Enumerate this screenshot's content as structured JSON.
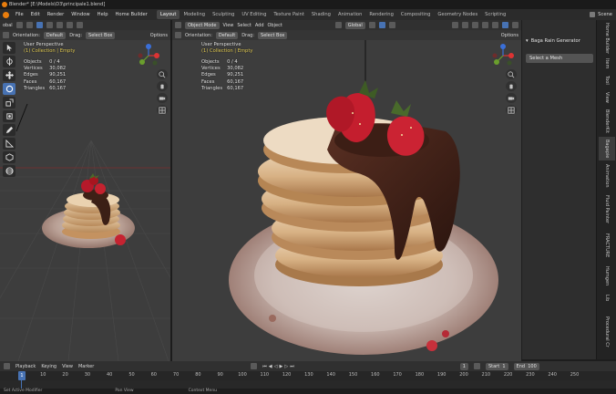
{
  "window": {
    "title": "Blender* [E:\\Models\\D3\\principale1.blend]"
  },
  "menu": [
    "File",
    "Edit",
    "Render",
    "Window",
    "Help",
    "Home Builder"
  ],
  "workspaces": [
    {
      "label": "Layout",
      "active": true
    },
    {
      "label": "Modeling",
      "active": false
    },
    {
      "label": "Sculpting",
      "active": false
    },
    {
      "label": "UV Editing",
      "active": false
    },
    {
      "label": "Texture Paint",
      "active": false
    },
    {
      "label": "Shading",
      "active": false
    },
    {
      "label": "Animation",
      "active": false
    },
    {
      "label": "Rendering",
      "active": false
    },
    {
      "label": "Compositing",
      "active": false
    },
    {
      "label": "Geometry Nodes",
      "active": false
    },
    {
      "label": "Scripting",
      "active": false
    }
  ],
  "scene_label": "Scene",
  "left_viewport": {
    "header": {
      "orientation_label": "Orientation:",
      "orientation_value": "Default",
      "drag_label": "Drag:",
      "drag_value": "Select Box",
      "options": "Options",
      "cut_label": "obal"
    },
    "view_name": "User Perspective",
    "collection": "(1) Collection | Empty",
    "stats": [
      [
        "Objects",
        "0 / 4"
      ],
      [
        "Vertices",
        "30,082"
      ],
      [
        "Edges",
        "90,251"
      ],
      [
        "Faces",
        "60,167"
      ],
      [
        "Triangles",
        "60,167"
      ]
    ]
  },
  "right_viewport": {
    "header": {
      "mode": "Object Mode",
      "view": "View",
      "select": "Select",
      "add": "Add",
      "object": "Object",
      "transform": "Global",
      "orientation_label": "Orientation:",
      "orientation_value": "Default",
      "drag_label": "Drag:",
      "drag_value": "Select Box",
      "options": "Options"
    },
    "view_name": "User Perspective",
    "collection": "(1) Collection | Empty",
    "stats": [
      [
        "Objects",
        "0 / 4"
      ],
      [
        "Vertices",
        "30,082"
      ],
      [
        "Edges",
        "90,251"
      ],
      [
        "Faces",
        "60,167"
      ],
      [
        "Triangles",
        "60,167"
      ]
    ]
  },
  "npanel": {
    "title": "Baga Rain Generator",
    "button": "Select a Mesh",
    "tabs": [
      "Home Builder",
      "Item",
      "Tool",
      "View",
      "BlenderKit",
      "Bagapie",
      "Animation",
      "Fluid Painter",
      "FRACTURE",
      "Humgen",
      "Lib",
      "Procedural Cr"
    ]
  },
  "timeline": {
    "playback": "Playback",
    "keying": "Keying",
    "view": "View",
    "marker": "Marker",
    "current_frame": "1",
    "start_label": "Start",
    "start_value": "1",
    "end_label": "End",
    "end_value": "100",
    "ticks": [
      "10",
      "20",
      "30",
      "40",
      "50",
      "60",
      "70",
      "80",
      "90",
      "100",
      "110",
      "120",
      "130",
      "140",
      "150",
      "160",
      "170",
      "180",
      "190",
      "200",
      "210",
      "220",
      "230",
      "240",
      "250"
    ],
    "cursor_frame": "1"
  },
  "statusbar": [
    "Set Active Modifier",
    "Pan View",
    "Context Menu"
  ],
  "colors": {
    "accent": "#4772b3",
    "active_tab": "#474747",
    "viewport_bg": "#3d3d3d",
    "header_bg": "#303030",
    "text_yellow": "#e8d15b"
  }
}
